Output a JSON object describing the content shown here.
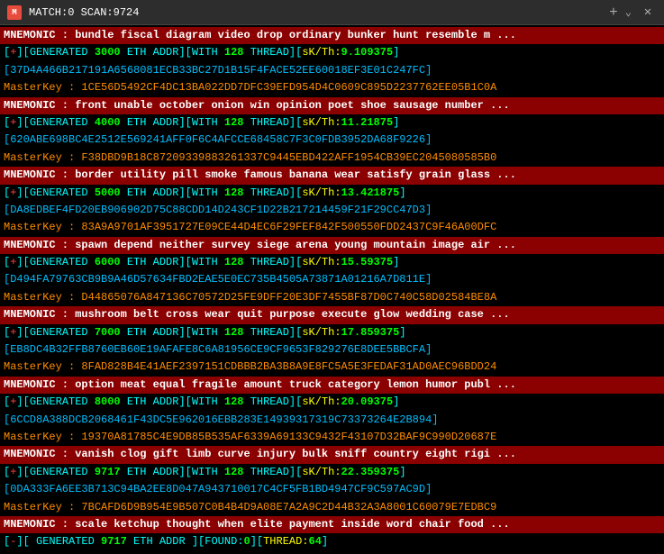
{
  "titleBar": {
    "icon": "M",
    "text": "MATCH:0 SCAN:9724",
    "closeLabel": "✕",
    "plusLabel": "+",
    "chevronLabel": "⌄"
  },
  "lines": [
    {
      "type": "mnemonic",
      "text": "MNEMONIC : bundle fiscal diagram video drop ordinary bunker hunt resemble m ..."
    },
    {
      "type": "generated",
      "prefix": "[+][GENERATED ",
      "num": "3000",
      "mid": " ETH ADDR][WITH ",
      "thread": "128",
      "suffix": " THREAD][sK/Th:",
      "sk": "9.109375",
      "end": "]"
    },
    {
      "type": "hash",
      "text": "[37D4A466B217191A6568081ECB33BC27D1B15F4FACE52EE60018EF3E01C247FC]"
    },
    {
      "type": "masterkey",
      "text": "MasterKey :  1CE56D5492CF4DC13BA022DD7DFC39EFD954D4C0609C895D2237762EE05B1C0A"
    },
    {
      "type": "mnemonic",
      "text": "MNEMONIC : front unable october onion win opinion poet shoe sausage number ..."
    },
    {
      "type": "generated",
      "prefix": "[+][GENERATED ",
      "num": "4000",
      "mid": " ETH ADDR][WITH ",
      "thread": "128",
      "suffix": " THREAD][sK/Th:",
      "sk": "11.21875",
      "end": "]"
    },
    {
      "type": "hash",
      "text": "[620ABE698BC4E2512E569241AFF0F6C4AFCCE68458C7F3C0FDB3952DA68F9226]"
    },
    {
      "type": "masterkey",
      "text": "MasterKey :  F38DBD9B18C87209339883261337C9445EBD422AFF1954CB39EC2045080585B0"
    },
    {
      "type": "mnemonic",
      "text": "MNEMONIC : border utility pill smoke famous banana wear satisfy grain glass ..."
    },
    {
      "type": "generated",
      "prefix": "[+][GENERATED ",
      "num": "5000",
      "mid": " ETH ADDR][WITH ",
      "thread": "128",
      "suffix": " THREAD][sK/Th:",
      "sk": "13.421875",
      "end": "]"
    },
    {
      "type": "hash",
      "text": "[DA8EDBEF4FD20EB906902D75C88CDD14D243CF1D22B217214459F21F29CC47D3]"
    },
    {
      "type": "masterkey",
      "text": "MasterKey :  83A9A9701AF3951727E09CE44D4EC6F29FEF842F500550FDD2437C9F46A00DFC"
    },
    {
      "type": "mnemonic",
      "text": "MNEMONIC : spawn depend neither survey siege arena young mountain image air ..."
    },
    {
      "type": "generated",
      "prefix": "[+][GENERATED ",
      "num": "6000",
      "mid": " ETH ADDR][WITH ",
      "thread": "128",
      "suffix": " THREAD][sK/Th:",
      "sk": "15.59375",
      "end": "]"
    },
    {
      "type": "hash",
      "text": "[D494FA79763CB9B9A46D57634FBD2EAE5E0EC735B4505A73871A01216A7D811E]"
    },
    {
      "type": "masterkey",
      "text": "MasterKey :  D44865076A847136C70572D25FE9DFF20E3DF7455BF87D0C740C58D02584BE8A"
    },
    {
      "type": "mnemonic",
      "text": "MNEMONIC : mushroom belt cross wear quit purpose execute glow wedding case ..."
    },
    {
      "type": "generated",
      "prefix": "[+][GENERATED ",
      "num": "7000",
      "mid": " ETH ADDR][WITH ",
      "thread": "128",
      "suffix": " THREAD][sK/Th:",
      "sk": "17.859375",
      "end": "]"
    },
    {
      "type": "hash",
      "text": "[EB8DC4B32FFB8760EB60E19AFAFE8C6A81956CE9CF9653F829276E8DEE5BBCFA]"
    },
    {
      "type": "masterkey",
      "text": "MasterKey :  8FAD828B4E41AEF2397151CDBBB2BA3B8A9E8FC5A5E3FEDAF31AD0AEC96BDD24"
    },
    {
      "type": "mnemonic",
      "text": "MNEMONIC : option meat equal fragile amount truck category lemon humor publ ..."
    },
    {
      "type": "generated",
      "prefix": "[+][GENERATED ",
      "num": "8000",
      "mid": " ETH ADDR][WITH ",
      "thread": "128",
      "suffix": " THREAD][sK/Th:",
      "sk": "20.09375",
      "end": "]"
    },
    {
      "type": "hash",
      "text": "[6CCD8A388DCB2068461F43DC5E962016EBB283E14939317319C73373264E2B894]"
    },
    {
      "type": "masterkey",
      "text": "MasterKey :  19370A81785C4E9DB85B535AF6339A69133C9432F43107D32BAF9C990D20687E"
    },
    {
      "type": "mnemonic",
      "text": "MNEMONIC : vanish clog gift limb curve injury bulk sniff country eight rigi ..."
    },
    {
      "type": "generated",
      "prefix": "[+][GENERATED ",
      "num": "9717",
      "mid": " ETH ADDR][WITH ",
      "thread": "128",
      "suffix": " THREAD][sK/Th:",
      "sk": "22.359375",
      "end": "]"
    },
    {
      "type": "hash",
      "text": "[0DA333FA6EE3B713C94BA2EE8D047A943710017C4CF5FB1BD4947CF9C597AC9D]"
    },
    {
      "type": "masterkey",
      "text": "MasterKey :  7BCAFD6D9B954E9B507C0B4B4D9A08E7A2A9C2D44B32A3A8001C60079E7EDBC9"
    },
    {
      "type": "mnemonic",
      "text": "MNEMONIC : scale ketchup thought when elite payment inside word chair food ..."
    }
  ],
  "footer": {
    "prefix": "[-][ GENERATED ",
    "num": "9717",
    "mid": " ETH ADDR ][FOUND:",
    "found": "0",
    "thread": "64",
    "suffix": "][THREAD:"
  }
}
